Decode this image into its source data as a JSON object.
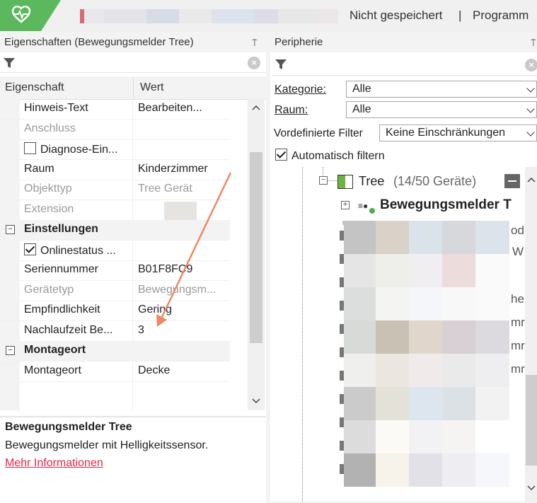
{
  "titlebar": {
    "status": "Nicht gespeichert",
    "separator": "|",
    "program": "Programm"
  },
  "properties_panel": {
    "title": "Eigenschaften (Bewegungsmelder Tree)",
    "pin": "⍑",
    "column_property": "Eigenschaft",
    "column_value": "Wert",
    "rows": [
      {
        "label": "Hinweis-Text",
        "value": "Bearbeiten..."
      },
      {
        "label": "Anschluss",
        "value": ""
      },
      {
        "label": "Diagnose-Ein...",
        "value": ""
      },
      {
        "label": "Raum",
        "value": "Kinderzimmer"
      },
      {
        "label": "Objekttyp",
        "value": "Tree Gerät"
      },
      {
        "label": "Extension",
        "value": ""
      },
      {
        "label": "Einstellungen",
        "value": ""
      },
      {
        "label": "Onlinestatus ...",
        "value": ""
      },
      {
        "label": "Seriennummer",
        "value": "B01F8FC9"
      },
      {
        "label": "Gerätetyp",
        "value": "Bewegungsm..."
      },
      {
        "label": "Empfindlichkeit",
        "value": "Gering"
      },
      {
        "label": "Nachlaufzeit Be...",
        "value": "3"
      },
      {
        "label": "Montageort",
        "value": ""
      },
      {
        "label": "Montageort",
        "value": "Decke"
      }
    ],
    "description": {
      "title": "Bewegungsmelder Tree",
      "text": "Bewegungsmelder mit Helligkeitssensor.",
      "link": "Mehr Informationen"
    }
  },
  "peripherie_panel": {
    "title": "Peripherie",
    "kategorie_label": "Kategorie:",
    "kategorie_value": "Alle",
    "raum_label": "Raum:",
    "raum_value": "Alle",
    "filter_label": "Vordefinierte Filter",
    "filter_value": "Keine Einschränkungen",
    "auto_filter_label": "Automatisch filtern",
    "auto_filter_checked": true,
    "tree_node": "Tree",
    "tree_count": "(14/50 Geräte)",
    "selected_device": "Bewegungsmelder T",
    "partial_texts": [
      "od",
      "W",
      "he",
      "mr",
      "mr",
      "mr"
    ]
  },
  "colors": {
    "accent_green": "#5cb85c",
    "link_red": "#e0284b",
    "arrow": "#ee8866"
  }
}
